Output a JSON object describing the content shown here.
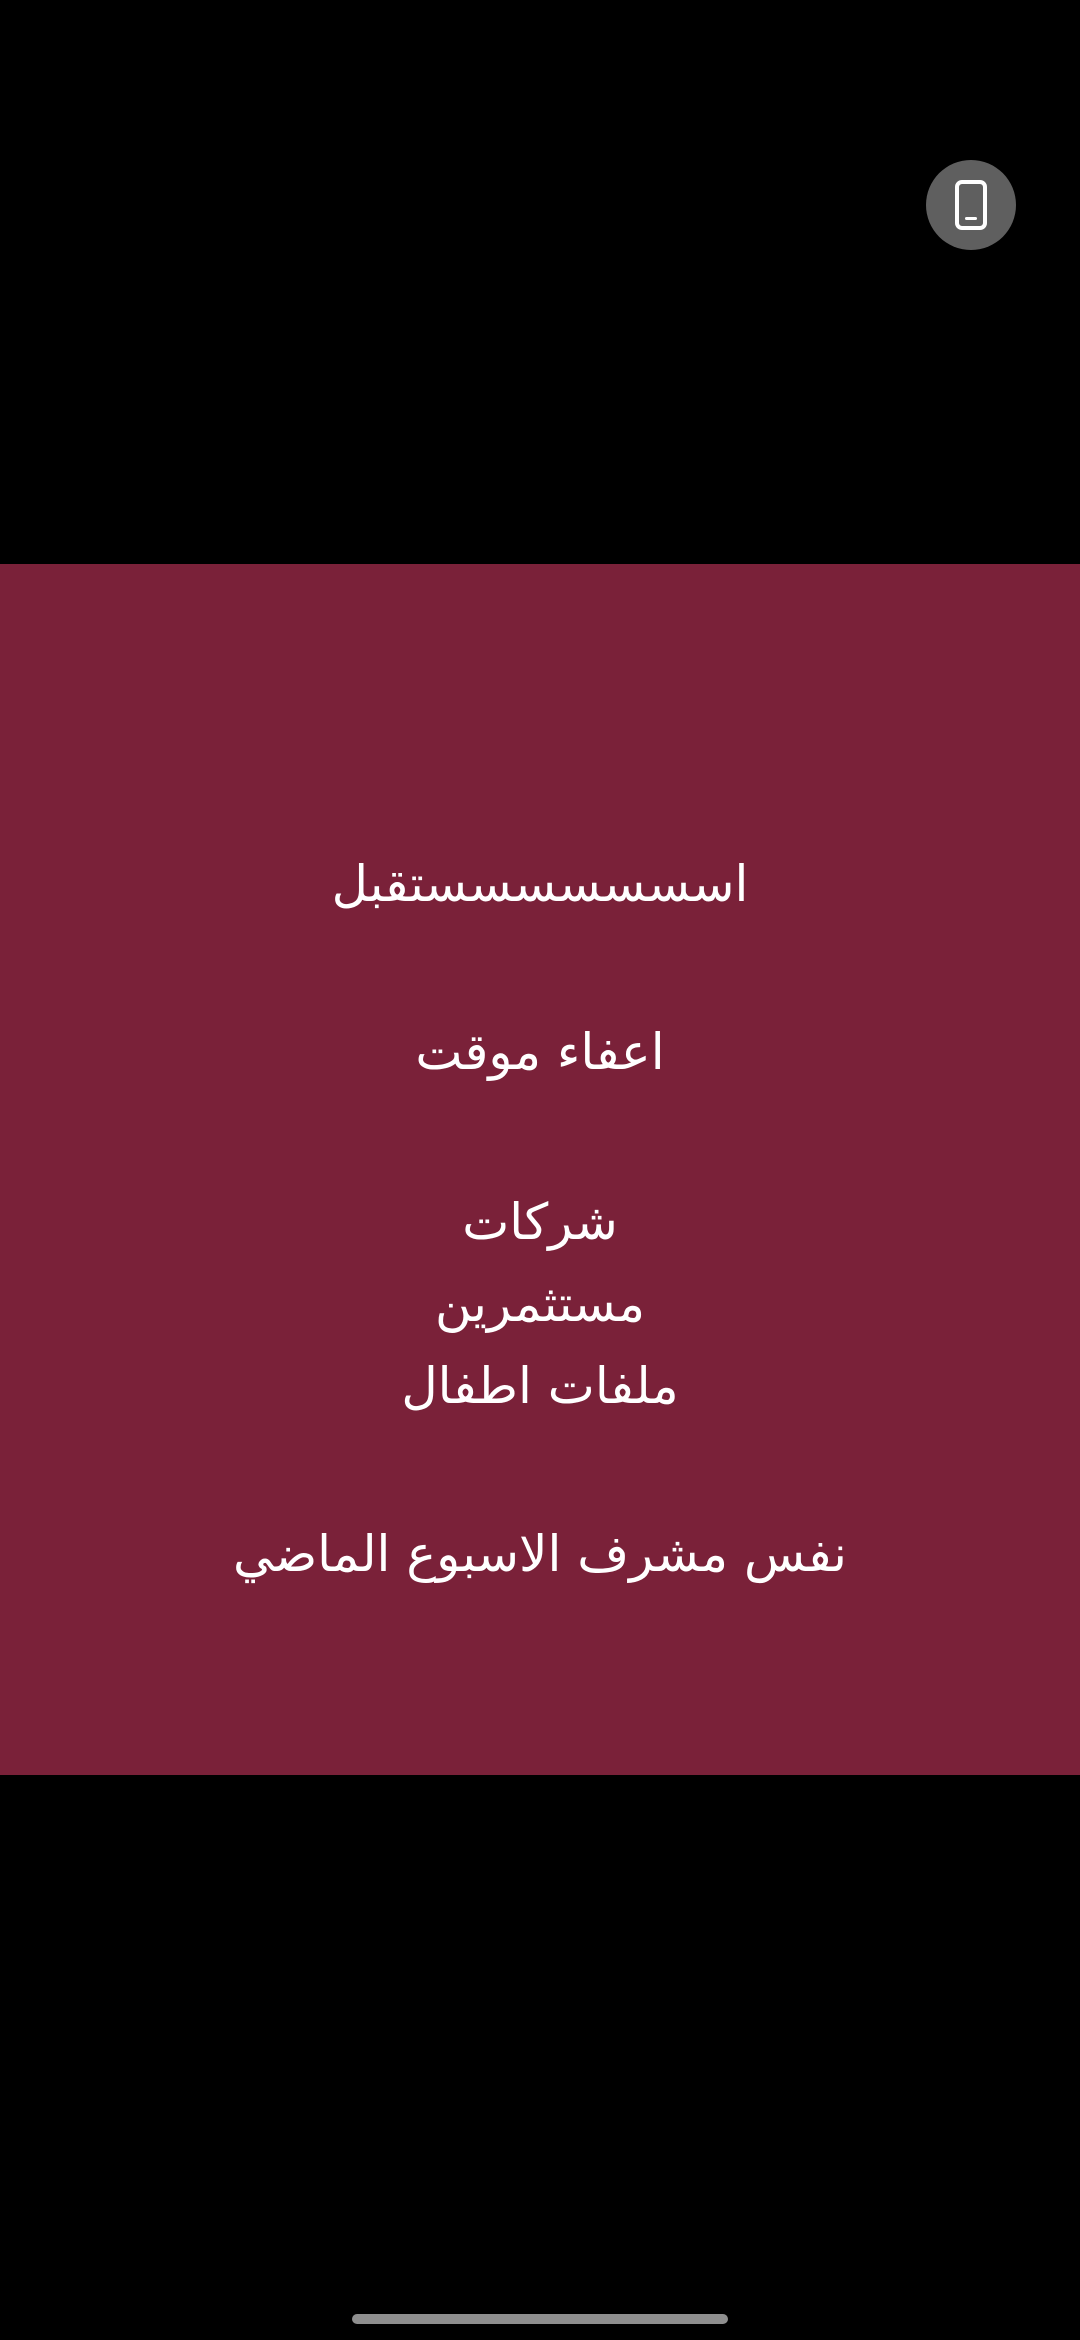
{
  "colors": {
    "background": "#000000",
    "story_background": "#7a2139",
    "text": "#ffffff",
    "device_button": "#5f5f5f",
    "home_indicator": "#8e8e8e"
  },
  "top_right_button": {
    "icon": "phone-icon"
  },
  "story": {
    "lines": [
      "اسسسسسسستقبل",
      "اعفاء موقت",
      "شركات",
      "مستثمرين",
      "ملفات اطفال",
      "نفس مشرف الاسبوع الماضي"
    ]
  }
}
